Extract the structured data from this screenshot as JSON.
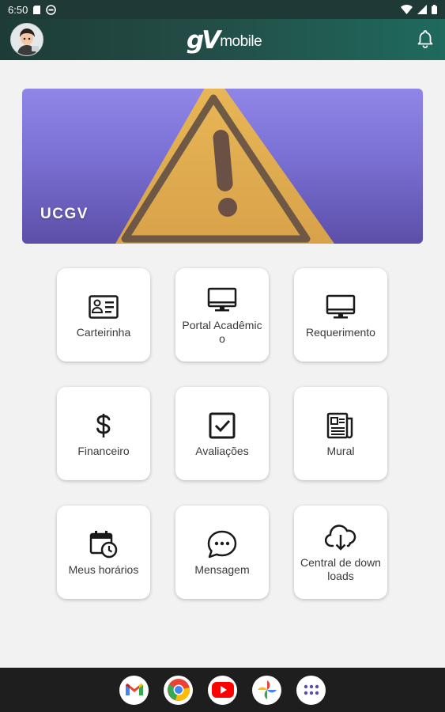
{
  "status_bar": {
    "time": "6:50"
  },
  "header": {
    "logo_mark": "gV",
    "logo_word": "mobile"
  },
  "banner": {
    "title": "UCGV"
  },
  "tiles": [
    {
      "label": "Carteirinha",
      "icon": "id-card-icon"
    },
    {
      "label": "Portal Acadêmico",
      "icon": "monitor-icon"
    },
    {
      "label": "Requerimento",
      "icon": "monitor-icon"
    },
    {
      "label": "Financeiro",
      "icon": "dollar-icon"
    },
    {
      "label": "Avaliações",
      "icon": "checkbox-icon"
    },
    {
      "label": "Mural",
      "icon": "newspaper-icon"
    },
    {
      "label": "Meus horários",
      "icon": "calendar-clock-icon"
    },
    {
      "label": "Mensagem",
      "icon": "chat-bubble-icon"
    },
    {
      "label": "Central de downloads",
      "icon": "cloud-download-icon"
    }
  ],
  "dock": [
    "gmail-icon",
    "chrome-icon",
    "youtube-icon",
    "photos-icon",
    "app-drawer-icon"
  ],
  "colors": {
    "header": "#1d3c37",
    "tile_bg": "#ffffff",
    "background": "#f2f2f2",
    "banner": "#7a70d4"
  }
}
